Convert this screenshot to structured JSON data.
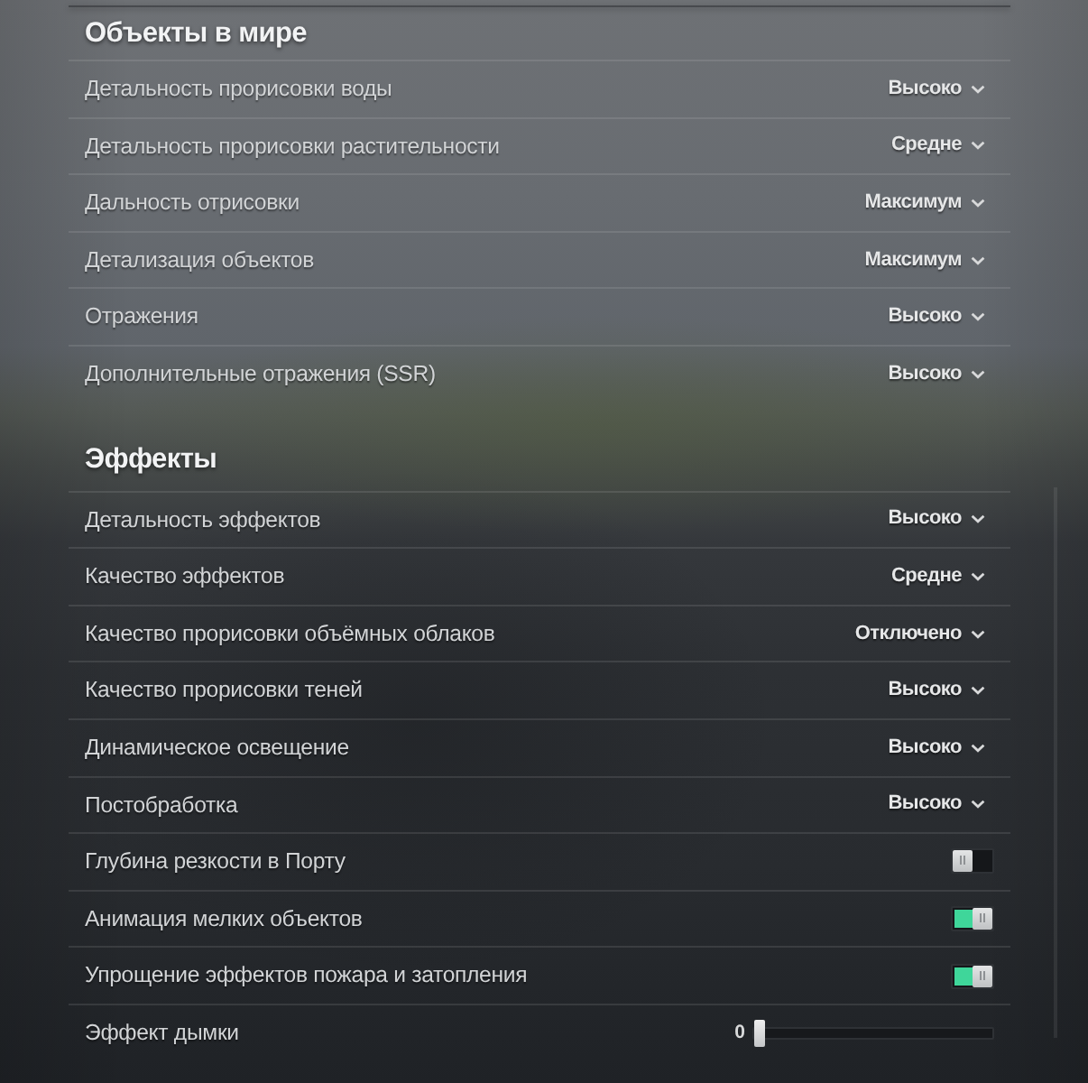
{
  "sections": [
    {
      "title": "Объекты в мире",
      "settings": [
        {
          "kind": "dropdown",
          "label": "Детальность прорисовки воды",
          "value": "Высоко"
        },
        {
          "kind": "dropdown",
          "label": "Детальность прорисовки растительности",
          "value": "Средне"
        },
        {
          "kind": "dropdown",
          "label": "Дальность отрисовки",
          "value": "Максимум"
        },
        {
          "kind": "dropdown",
          "label": "Детализация объектов",
          "value": "Максимум"
        },
        {
          "kind": "dropdown",
          "label": "Отражения",
          "value": "Высоко"
        },
        {
          "kind": "dropdown",
          "label": "Дополнительные отражения (SSR)",
          "value": "Высоко"
        }
      ]
    },
    {
      "title": "Эффекты",
      "settings": [
        {
          "kind": "dropdown",
          "label": "Детальность эффектов",
          "value": "Высоко"
        },
        {
          "kind": "dropdown",
          "label": "Качество эффектов",
          "value": "Средне"
        },
        {
          "kind": "dropdown",
          "label": "Качество прорисовки объёмных облаков",
          "value": "Отключено"
        },
        {
          "kind": "dropdown",
          "label": "Качество прорисовки теней",
          "value": "Высоко"
        },
        {
          "kind": "dropdown",
          "label": "Динамическое освещение",
          "value": "Высоко"
        },
        {
          "kind": "dropdown",
          "label": "Постобработка",
          "value": "Высоко"
        },
        {
          "kind": "toggle",
          "label": "Глубина резкости в Порту",
          "on": false
        },
        {
          "kind": "toggle",
          "label": "Анимация мелких объектов",
          "on": true
        },
        {
          "kind": "toggle",
          "label": "Упрощение эффектов пожара и затопления",
          "on": true
        },
        {
          "kind": "slider",
          "label": "Эффект дымки",
          "reading": "0",
          "level": 0
        }
      ]
    }
  ]
}
